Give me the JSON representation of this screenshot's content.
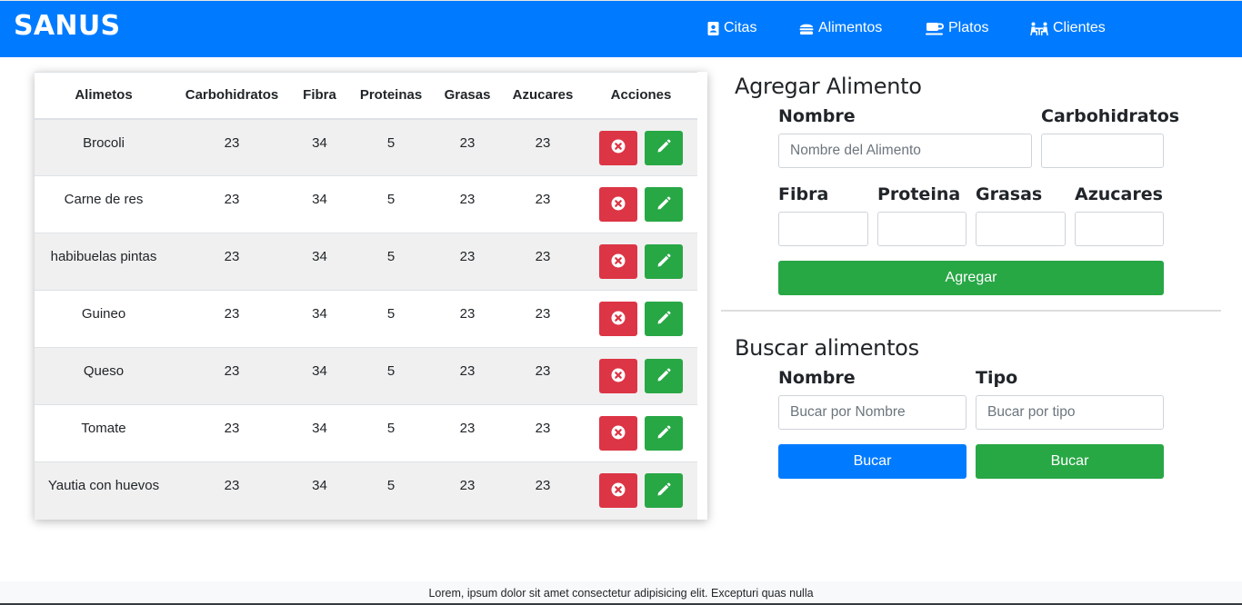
{
  "brand": "SANUS",
  "nav": [
    {
      "label": "Citas",
      "icon": "address-book-icon"
    },
    {
      "label": "Alimentos",
      "icon": "hamburger-icon"
    },
    {
      "label": "Platos",
      "icon": "coffee-cup-icon"
    },
    {
      "label": "Clientes",
      "icon": "people-at-table-icon"
    }
  ],
  "table": {
    "headers": [
      "Alimetos",
      "Carbohidratos",
      "Fibra",
      "Proteinas",
      "Grasas",
      "Azucares",
      "Acciones"
    ],
    "rows": [
      [
        "Brocoli",
        "23",
        "34",
        "5",
        "23",
        "23"
      ],
      [
        "Carne de res",
        "23",
        "34",
        "5",
        "23",
        "23"
      ],
      [
        "habibuelas pintas",
        "23",
        "34",
        "5",
        "23",
        "23"
      ],
      [
        "Guineo",
        "23",
        "34",
        "5",
        "23",
        "23"
      ],
      [
        "Queso",
        "23",
        "34",
        "5",
        "23",
        "23"
      ],
      [
        "Tomate",
        "23",
        "34",
        "5",
        "23",
        "23"
      ],
      [
        "Yautia con huevos",
        "23",
        "34",
        "5",
        "23",
        "23"
      ]
    ]
  },
  "add_form": {
    "title": "Agregar Alimento",
    "nombre_label": "Nombre",
    "nombre_placeholder": "Nombre del Alimento",
    "carbohidratos_label": "Carbohidratos",
    "fibra_label": "Fibra",
    "proteina_label": "Proteina",
    "grasas_label": "Grasas",
    "azucares_label": "Azucares",
    "submit_label": "Agregar"
  },
  "search_form": {
    "title": "Buscar alimentos",
    "nombre_label": "Nombre",
    "nombre_placeholder": "Bucar por Nombre",
    "tipo_label": "Tipo",
    "tipo_placeholder": "Bucar por tipo",
    "button_nombre_label": "Bucar",
    "button_tipo_label": "Bucar"
  },
  "footer": "Lorem, ipsum dolor sit amet consectetur adipisicing elit. Excepturi quas nulla",
  "colors": {
    "primary": "#007bff",
    "success": "#28a745",
    "danger": "#dc3545",
    "striped_row": "#f0f0f0"
  }
}
